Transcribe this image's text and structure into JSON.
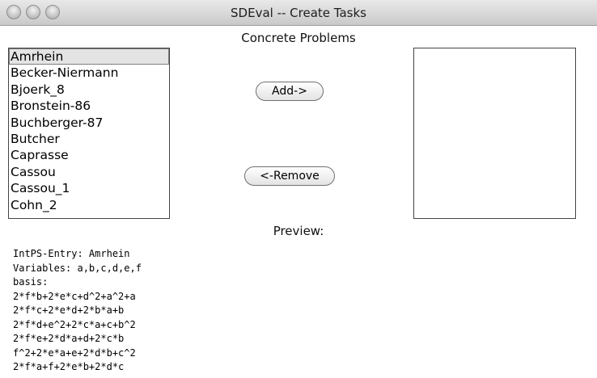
{
  "window": {
    "title": "SDEval -- Create Tasks"
  },
  "heading": "Concrete Problems",
  "problems": [
    "Amrhein",
    "Becker-Niermann",
    "Bjoerk_8",
    "Bronstein-86",
    "Buchberger-87",
    "Butcher",
    "Caprasse",
    "Cassou",
    "Cassou_1",
    "Cohn_2"
  ],
  "selected_problem": "Amrhein",
  "buttons": {
    "add": "Add->",
    "remove": "<-Remove"
  },
  "preview": {
    "label": "Preview:",
    "lines": [
      "IntPS-Entry: Amrhein",
      "Variables: a,b,c,d,e,f",
      "basis:",
      "2*f*b+2*e*c+d^2+a^2+a",
      "2*f*c+2*e*d+2*b*a+b",
      "2*f*d+e^2+2*c*a+c+b^2",
      "2*f*e+2*d*a+d+2*c*b",
      "f^2+2*e*a+e+2*d*b+c^2",
      "2*f*a+f+2*e*b+2*d*c"
    ]
  }
}
